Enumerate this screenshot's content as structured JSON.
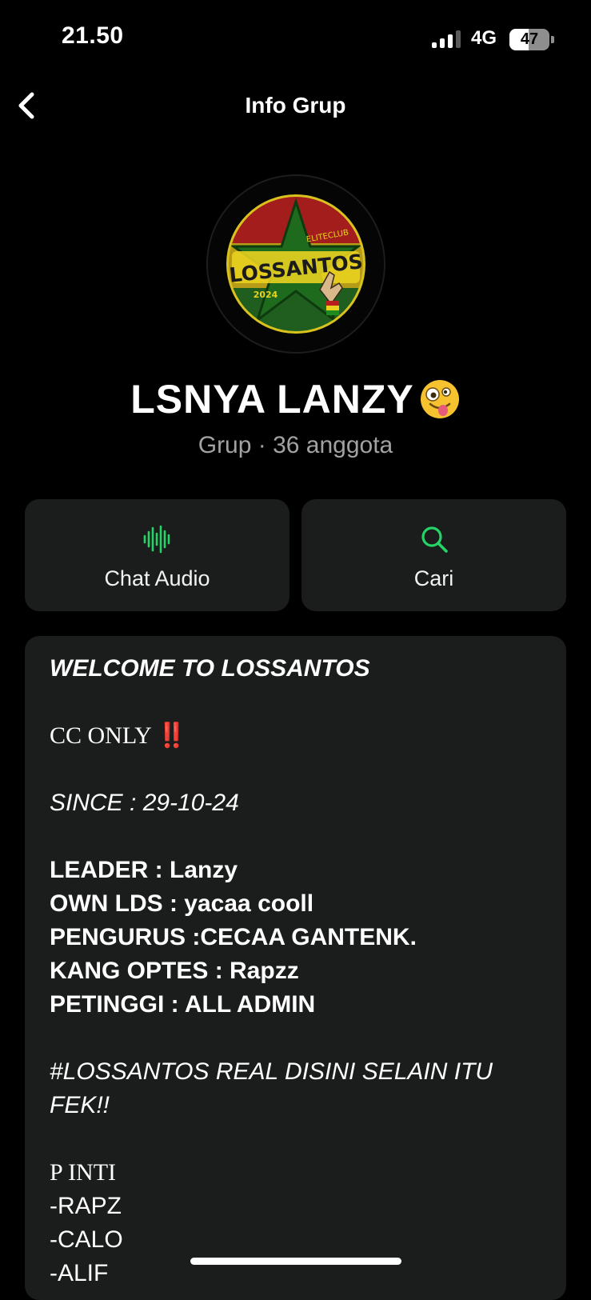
{
  "status_bar": {
    "time": "21.50",
    "network": "4G",
    "battery_level": "47",
    "battery_fraction": 0.47
  },
  "nav": {
    "title": "Info Grup",
    "back_icon": "chevron-left-icon"
  },
  "group": {
    "avatar_logo_text": "LOSSANTOS",
    "avatar_logo_subtext": "ELITECLUB",
    "avatar_logo_year": "2024",
    "name": "LSNYA LANZY",
    "name_emoji": "zany-face-emoji",
    "meta": "Grup · 36 anggota"
  },
  "actions": [
    {
      "label": "Chat Audio",
      "icon": "audio-waveform-icon"
    },
    {
      "label": "Cari",
      "icon": "search-icon"
    }
  ],
  "description_lines": [
    "WELCOME TO LOSSANTOS",
    "",
    "CC ONLY ‼️",
    "",
    "SINCE : 29-10-24",
    "",
    "LEADER : Lanzy",
    "OWN LDS : yacaa cooll",
    "PENGURUS :CECAA GANTENK.",
    "KANG OPTES : Rapzz",
    "PETINGGI : ALL ADMIN",
    "",
    "#LOSSANTOS REAL DISINI SELAIN ITU",
    "FEK!!",
    "",
    "P INTI",
    "-RAPZ",
    "-CALO",
    "-ALIF"
  ],
  "colors": {
    "background": "#000000",
    "card": "#1b1c1c",
    "accent_green": "#25d366",
    "muted_text": "#a2a2a2"
  }
}
